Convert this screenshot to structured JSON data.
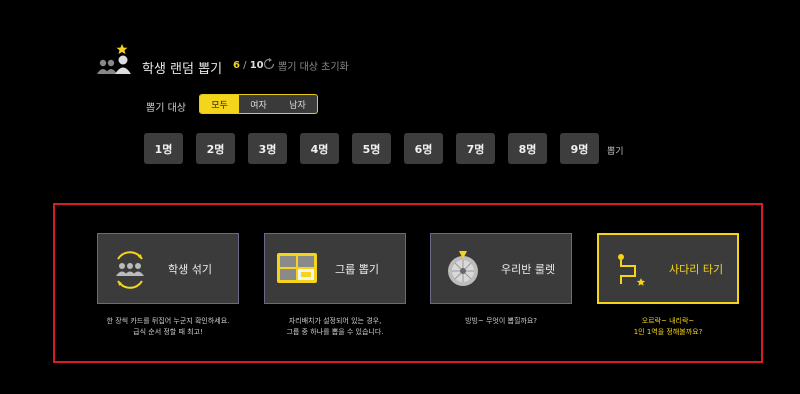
{
  "header": {
    "title": "학생 랜덤 뽑기",
    "count_current": "6",
    "count_sep": " / ",
    "count_total": "10",
    "reset_label": "뽑기 대상 초기화"
  },
  "filter": {
    "label": "뽑기 대상",
    "options": [
      "모두",
      "여자",
      "남자"
    ],
    "selected": "모두"
  },
  "numbers": [
    "1명",
    "2명",
    "3명",
    "4명",
    "5명",
    "6명",
    "7명",
    "8명",
    "9명"
  ],
  "pick_label": "뽑기",
  "modes": [
    {
      "label": "학생 섞기",
      "icon": "students-shuffle-icon",
      "desc": [
        "한 장씩 카드를 뒤집어 누군지 확인하세요.",
        "급식 순서 정할 때 최고!"
      ]
    },
    {
      "label": "그룹 뽑기",
      "icon": "group-board-icon",
      "desc": [
        "자리배치가 설정되어 있는 경우,",
        "그룹 중 하나를 뽑을 수 있습니다."
      ]
    },
    {
      "label": "우리반 룰렛",
      "icon": "roulette-icon",
      "desc": [
        "빙빙~ 무엇이 뽑힐까요?",
        ""
      ]
    },
    {
      "label": "사다리 타기",
      "icon": "ladder-icon",
      "desc": [
        "오르락~ 내리락~",
        "1인 1역을 정해볼까요?"
      ]
    }
  ],
  "colors": {
    "accent": "#f5d51c",
    "highlight_border": "#d71c25",
    "button_bg": "#3d3d3d"
  }
}
